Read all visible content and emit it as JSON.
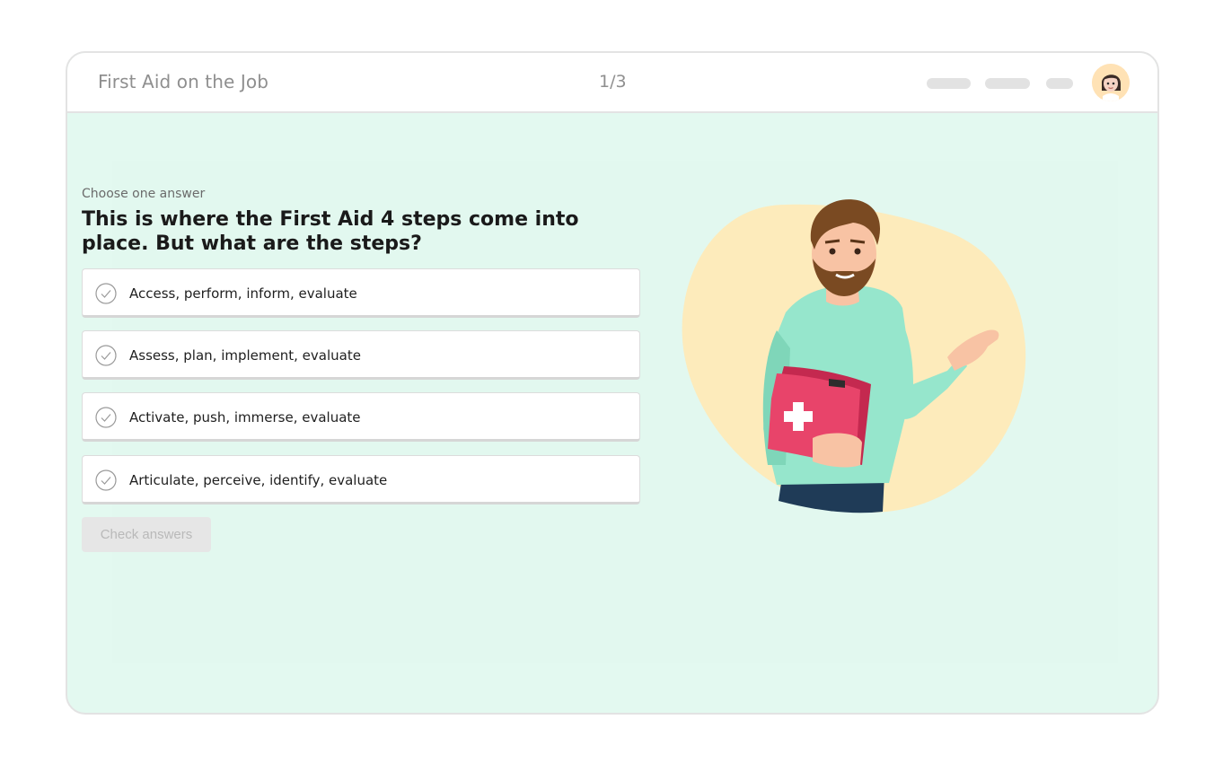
{
  "header": {
    "title": "First Aid on the Job",
    "progress": "1/3",
    "avatar_icon": "user-avatar-icon"
  },
  "quiz": {
    "hint": "Choose one answer",
    "question": "This is where the First Aid 4 steps come into place. But what are the steps?",
    "options": [
      {
        "label": "Access, perform, inform, evaluate",
        "icon": "check-circle-icon"
      },
      {
        "label": "Assess, plan, implement, evaluate",
        "icon": "check-circle-icon"
      },
      {
        "label": "Activate, push, immerse, evaluate",
        "icon": "check-circle-icon"
      },
      {
        "label": "Articulate, perceive, identify, evaluate",
        "icon": "check-circle-icon"
      }
    ],
    "submit_label": "Check answers"
  },
  "colors": {
    "background": "#e3f9f0",
    "blob": "#fdebbb",
    "shirt": "#96e6cc",
    "kit": "#e8446a"
  }
}
